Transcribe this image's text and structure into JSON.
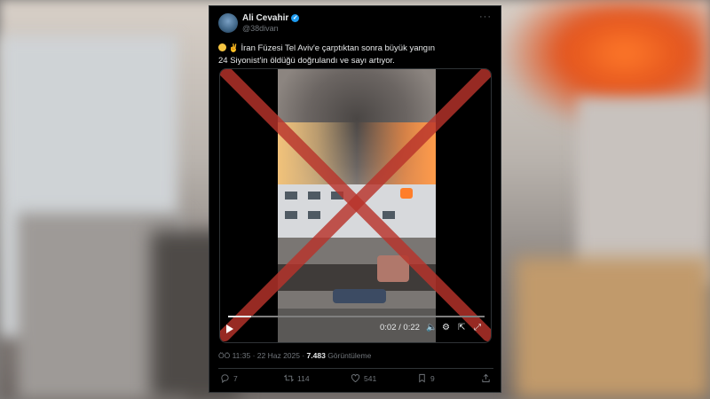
{
  "tweet": {
    "author_name": "Ali Cevahir",
    "handle": "@38divan",
    "more_label": "···",
    "text_line1": "İran Füzesi Tel Aviv'e çarptıktan sonra büyük yangın",
    "text_line2": "24 Siyonist'in öldüğü doğrulandı ve sayı artıyor.",
    "timestamp": "ÖÖ 11:35 · 22 Haz 2025 · ",
    "views": "7.483",
    "views_label": " Görüntüleme"
  },
  "video": {
    "time": "0:02 / 0:22",
    "progress": 0.09
  },
  "actions": {
    "replies": "7",
    "retweets": "114",
    "likes": "541",
    "bookmarks": "9"
  },
  "colors": {
    "accent": "#1d9bf0",
    "cross": "#c0392b",
    "card_bg": "#000000",
    "muted": "#71767b"
  }
}
